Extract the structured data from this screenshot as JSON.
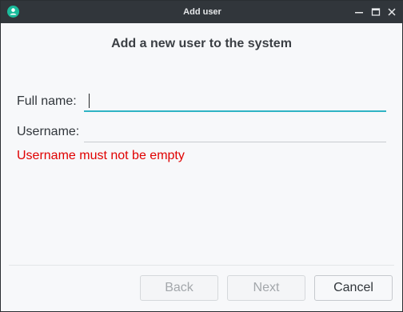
{
  "window": {
    "title": "Add user",
    "app_icon": "user-avatar-icon",
    "controls": {
      "minimize_icon": "minimize-icon",
      "maximize_icon": "maximize-icon",
      "close_icon": "close-icon"
    }
  },
  "dialog": {
    "heading": "Add a new user to the system",
    "fields": {
      "full_name": {
        "label": "Full name:",
        "value": "",
        "placeholder": "",
        "focused": true
      },
      "username": {
        "label": "Username:",
        "value": "",
        "placeholder": ""
      }
    },
    "error_message": "Username must not be empty"
  },
  "buttons": {
    "back": {
      "label": "Back",
      "enabled": false
    },
    "next": {
      "label": "Next",
      "enabled": false
    },
    "cancel": {
      "label": "Cancel",
      "enabled": true
    }
  },
  "colors": {
    "titlebar_bg": "#31363b",
    "window_bg": "#f7f8fa",
    "focus_accent": "#2fb3c4",
    "error": "#e00000",
    "app_icon": "#1abc9c"
  }
}
